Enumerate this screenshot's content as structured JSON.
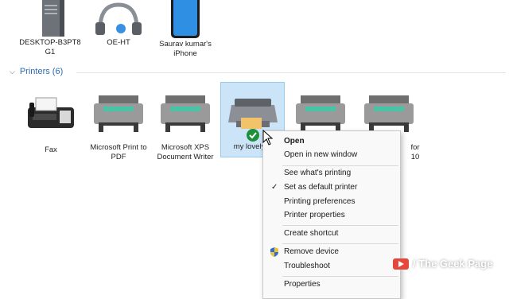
{
  "devices": [
    {
      "name": "DESKTOP-B3PT8\nG1",
      "icon": "desktop-tower-icon"
    },
    {
      "name": "OE-HT",
      "icon": "headset-icon"
    },
    {
      "name": "Saurav kumar's\niPhone",
      "icon": "phone-icon"
    }
  ],
  "printers_header": "Printers (6)",
  "printers": [
    {
      "name": "Fax",
      "icon": "fax-icon"
    },
    {
      "name": "Microsoft Print to\nPDF",
      "icon": "printer-icon"
    },
    {
      "name": "Microsoft XPS\nDocument Writer",
      "icon": "printer-icon"
    },
    {
      "name": "my lovely p",
      "icon": "printer-icon",
      "selected": true,
      "default": true
    },
    {
      "name": "",
      "icon": "printer-icon"
    },
    {
      "name": "for\n10",
      "icon": "printer-icon"
    }
  ],
  "context_menu": {
    "items": [
      {
        "label": "Open",
        "bold": true
      },
      {
        "label": "Open in new window"
      },
      {
        "label": "See what's printing"
      },
      {
        "label": "Set as default printer",
        "checked": true
      },
      {
        "label": "Printing preferences"
      },
      {
        "label": "Printer properties"
      },
      {
        "label": "Create shortcut"
      },
      {
        "label": "Remove device",
        "icon": "uac-shield-icon"
      },
      {
        "label": "Troubleshoot"
      },
      {
        "label": "Properties"
      }
    ]
  },
  "watermark": {
    "text": "/ The Geek Page"
  },
  "colors": {
    "accent": "#2a6bb0",
    "selection": "#cce4f7",
    "default_check": "#1e8f3a"
  }
}
